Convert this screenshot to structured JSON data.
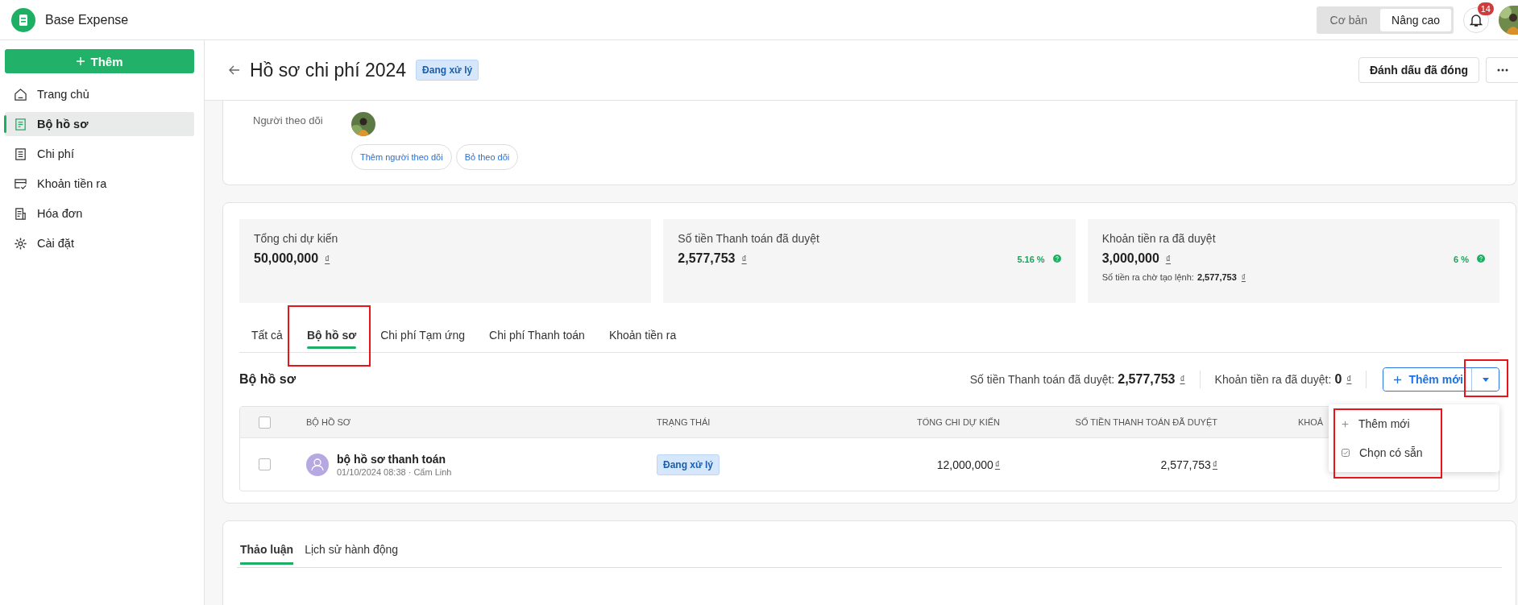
{
  "app": {
    "name": "Base Expense"
  },
  "mode_switch": [
    {
      "label": "Cơ bản",
      "selected": false
    },
    {
      "label": "Nâng cao",
      "selected": true
    }
  ],
  "notifications": {
    "count": "14"
  },
  "sidebar": {
    "add_button": "Thêm",
    "items": [
      {
        "kind": "home",
        "label": "Trang chủ",
        "selected": false
      },
      {
        "kind": "folder",
        "label": "Bộ hồ sơ",
        "selected": true
      },
      {
        "kind": "list",
        "label": "Chi phí",
        "selected": false
      },
      {
        "kind": "card",
        "label": "Khoản tiền ra",
        "selected": false
      },
      {
        "kind": "invoice",
        "label": "Hóa đơn",
        "selected": false
      },
      {
        "kind": "gear",
        "label": "Cài đặt",
        "selected": false
      }
    ]
  },
  "page": {
    "title": "Hồ sơ chi phí 2024",
    "status": "Đang xử lý",
    "action": "Đánh dấu đã đóng"
  },
  "followers": {
    "label": "Người theo dõi",
    "buttons": [
      "Thêm người theo dõi",
      "Bỏ theo dõi"
    ]
  },
  "stats": [
    {
      "label": "Tổng chi dự kiến",
      "value": "50,000,000",
      "currency": "₫"
    },
    {
      "label": "Số tiền Thanh toán đã duyệt",
      "value": "2,577,753",
      "currency": "₫",
      "percent": "5.16 %"
    },
    {
      "label": "Khoản tiền ra đã duyệt",
      "value": "3,000,000",
      "currency": "₫",
      "percent": "6 %",
      "note": {
        "label": "Số tiền ra chờ tạo lệnh:",
        "value": "2,577,753",
        "currency": "₫"
      }
    }
  ],
  "tabs": [
    {
      "label": "Tất cả",
      "selected": false,
      "highlighted": false
    },
    {
      "label": "Bộ hồ sơ",
      "selected": true,
      "highlighted": true
    },
    {
      "label": "Chi phí Tạm ứng",
      "selected": false,
      "highlighted": false
    },
    {
      "label": "Chi phí Thanh toán",
      "selected": false,
      "highlighted": false
    },
    {
      "label": "Khoản tiền ra",
      "selected": false,
      "highlighted": false
    }
  ],
  "section": {
    "title": "Bộ hồ sơ",
    "summary": [
      {
        "label": "Số tiền Thanh toán đã duyệt:",
        "value": "2,577,753",
        "currency": "₫"
      },
      {
        "label": "Khoản tiền ra đã duyệt:",
        "value": "0",
        "currency": "₫"
      }
    ],
    "add_button": "Thêm mới",
    "dropdown_highlighted": true
  },
  "menu": {
    "highlighted": true,
    "items": [
      {
        "kind": "add",
        "label": "Thêm mới"
      },
      {
        "kind": "pick",
        "label": "Chọn có sẵn"
      }
    ]
  },
  "table": {
    "all_checked": false,
    "columns": [
      "BỘ HỒ SƠ",
      "TRẠNG THÁI",
      "TỔNG CHI DỰ KIẾN",
      "SỐ TIỀN THANH TOÁN ĐÃ DUYỆT",
      "KHOẢ"
    ],
    "rows": [
      {
        "checked": false,
        "name": "bộ hồ sơ thanh toán",
        "meta": "01/10/2024 08:38 · Cẩm Linh",
        "status": "Đang xử lý",
        "planned": "12,000,000",
        "planned_currency": "₫",
        "approved": "2,577,753",
        "approved_currency": "₫"
      }
    ]
  },
  "discussion_tabs": [
    {
      "label": "Thảo luận",
      "selected": true
    },
    {
      "label": "Lịch sử hành động",
      "selected": false
    }
  ]
}
